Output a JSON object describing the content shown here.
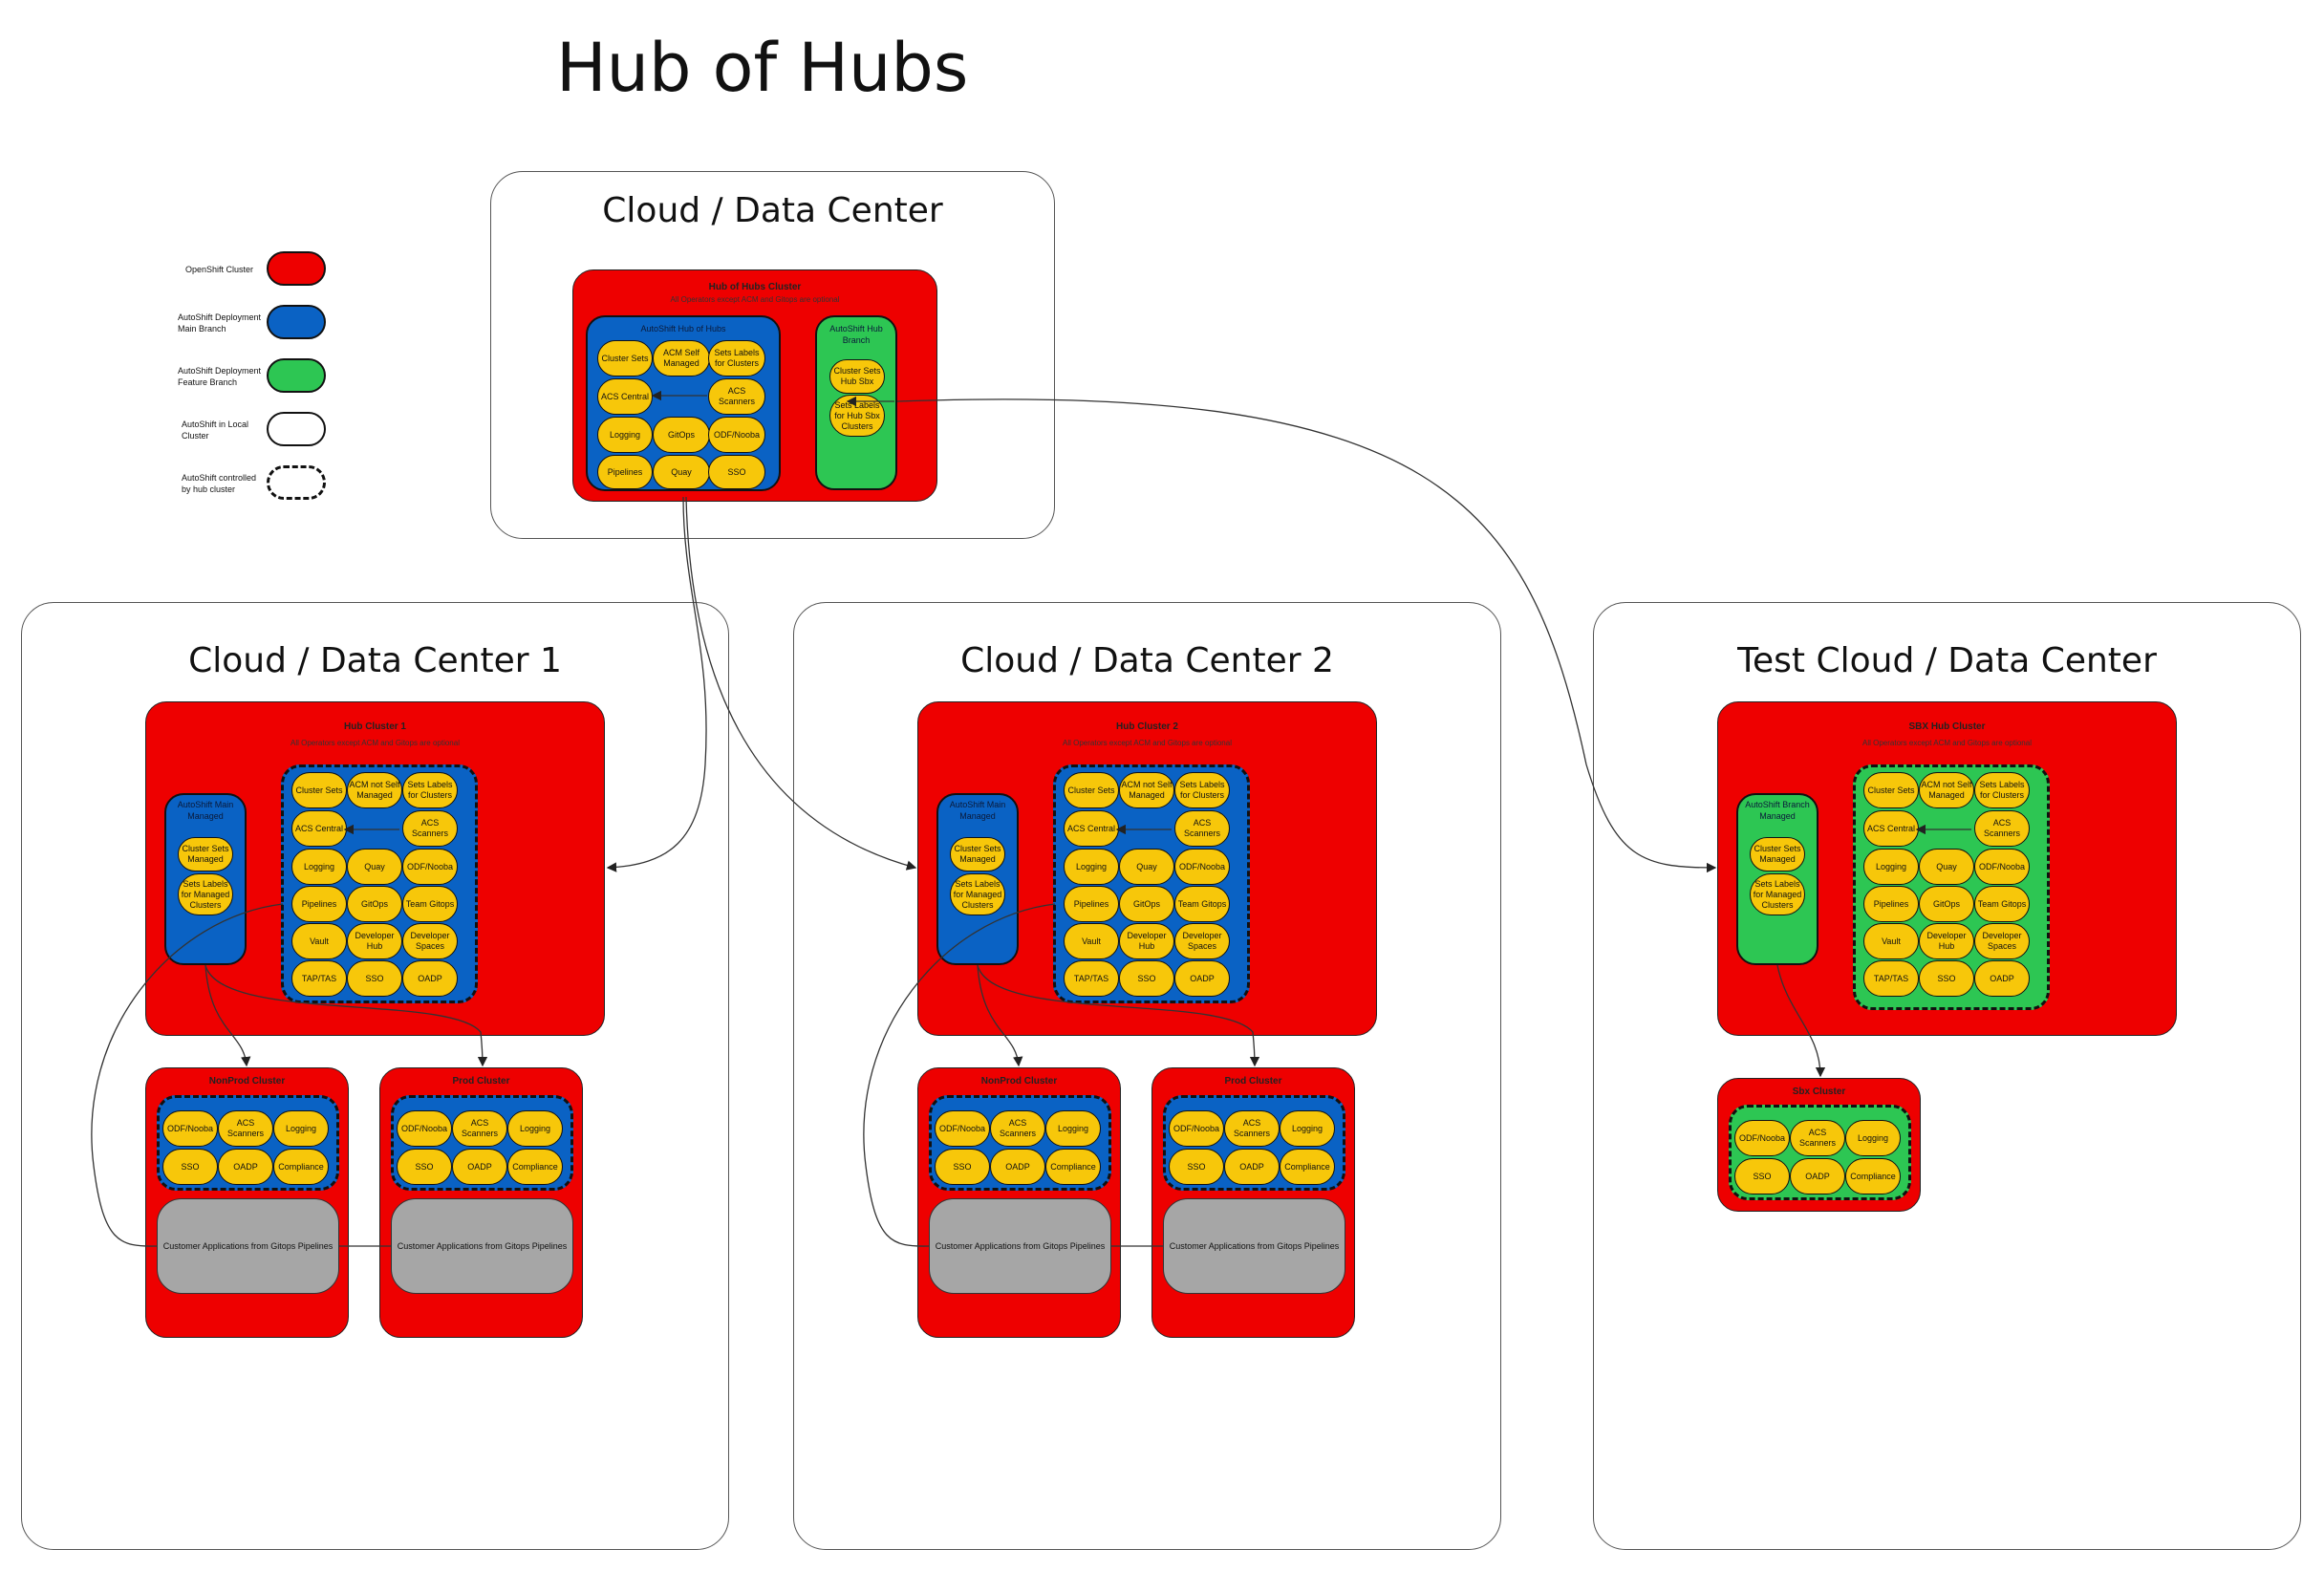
{
  "title": "Hub of Hubs",
  "legend": [
    {
      "label": "OpenShift Cluster",
      "color": "#ee0000",
      "style": "solid"
    },
    {
      "label": "AutoShift Deployment Main Branch",
      "color": "#0a62c4",
      "style": "solid"
    },
    {
      "label": "AutoShift Deployment Feature Branch",
      "color": "#2dc653",
      "style": "solid"
    },
    {
      "label": "AutoShift in Local Cluster",
      "color": "#ffffff",
      "style": "solid"
    },
    {
      "label": "AutoShift controlled by hub cluster",
      "color": "#ffffff",
      "style": "dashed"
    }
  ],
  "regions": {
    "top": {
      "title": "Cloud / Data Center"
    },
    "dc1": {
      "title": "Cloud / Data Center 1"
    },
    "dc2": {
      "title": "Cloud / Data Center 2"
    },
    "test": {
      "title": "Test Cloud / Data Center"
    }
  },
  "hoh": {
    "title": "Hub of Hubs Cluster",
    "subtitle": "All Operators except ACM and Gitops are optional",
    "main_label": "AutoShift Hub of Hubs",
    "main_items": [
      "Cluster Sets",
      "ACM Self Managed",
      "Sets Labels for Clusters",
      "ACS Central",
      "ACS Scanners",
      "Logging",
      "GitOps",
      "ODF/Nooba",
      "Pipelines",
      "Quay",
      "SSO"
    ],
    "branch_label": "AutoShift Hub Branch",
    "branch_items": [
      "Cluster Sets Hub Sbx",
      "Sets Labels for Hub Sbx Clusters"
    ]
  },
  "hubs": [
    {
      "title": "Hub Cluster 1",
      "subtitle": "All Operators except ACM and Gitops are optional",
      "side_label": "AutoShift Main Managed",
      "side_items": [
        "Cluster Sets Managed",
        "Sets Labels for Managed Clusters"
      ],
      "items": [
        "Cluster Sets",
        "ACM not Self Managed",
        "Sets Labels for Clusters",
        "ACS Central",
        "ACS Scanners",
        "Logging",
        "Quay",
        "ODF/Nooba",
        "Pipelines",
        "GitOps",
        "Team Gitops",
        "Vault",
        "Developer Hub",
        "Developer Spaces",
        "TAP/TAS",
        "SSO",
        "OADP"
      ],
      "nonprod": {
        "title": "NonProd Cluster",
        "items": [
          "ODF/Nooba",
          "ACS Scanners",
          "Logging",
          "SSO",
          "OADP",
          "Compliance"
        ],
        "apps": "Customer Applications from Gitops Pipelines"
      },
      "prod": {
        "title": "Prod Cluster",
        "items": [
          "ODF/Nooba",
          "ACS Scanners",
          "Logging",
          "SSO",
          "OADP",
          "Compliance"
        ],
        "apps": "Customer Applications from Gitops Pipelines"
      }
    },
    {
      "title": "Hub Cluster 2",
      "subtitle": "All Operators except ACM and Gitops are optional",
      "side_label": "AutoShift Main Managed",
      "side_items": [
        "Cluster Sets Managed",
        "Sets Labels for Managed Clusters"
      ],
      "items": [
        "Cluster Sets",
        "ACM not Self Managed",
        "Sets Labels for Clusters",
        "ACS Central",
        "ACS Scanners",
        "Logging",
        "Quay",
        "ODF/Nooba",
        "Pipelines",
        "GitOps",
        "Team Gitops",
        "Vault",
        "Developer Hub",
        "Developer Spaces",
        "TAP/TAS",
        "SSO",
        "OADP"
      ],
      "nonprod": {
        "title": "NonProd Cluster",
        "items": [
          "ODF/Nooba",
          "ACS Scanners",
          "Logging",
          "SSO",
          "OADP",
          "Compliance"
        ],
        "apps": "Customer Applications from Gitops Pipelines"
      },
      "prod": {
        "title": "Prod Cluster",
        "items": [
          "ODF/Nooba",
          "ACS Scanners",
          "Logging",
          "SSO",
          "OADP",
          "Compliance"
        ],
        "apps": "Customer Applications from Gitops Pipelines"
      }
    }
  ],
  "sbx_hub": {
    "title": "SBX Hub Cluster",
    "subtitle": "All Operators except ACM and Gitops are optional",
    "side_label": "AutoShift Branch Managed",
    "side_items": [
      "Cluster Sets Managed",
      "Sets Labels for Managed Clusters"
    ],
    "items": [
      "Cluster Sets",
      "ACM not Self Managed",
      "Sets Labels for Clusters",
      "ACS Central",
      "ACS Scanners",
      "Logging",
      "Quay",
      "ODF/Nooba",
      "Pipelines",
      "GitOps",
      "Team Gitops",
      "Vault",
      "Developer Hub",
      "Developer Spaces",
      "TAP/TAS",
      "SSO",
      "OADP"
    ],
    "sbx": {
      "title": "Sbx Cluster",
      "items": [
        "ODF/Nooba",
        "ACS Scanners",
        "Logging",
        "SSO",
        "OADP",
        "Compliance"
      ]
    }
  },
  "colors": {
    "cluster": "#ee0000",
    "main_branch": "#0a62c4",
    "feature_branch": "#2dc653",
    "operator": "#f7c70a",
    "apps": "#a6a6a6"
  }
}
